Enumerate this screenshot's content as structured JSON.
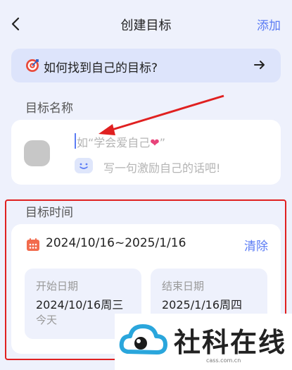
{
  "header": {
    "title": "创建目标",
    "add_label": "添加"
  },
  "tip": {
    "text": "如何找到自己的目标?"
  },
  "name_section": {
    "label": "目标名称",
    "name_placeholder_prefix": "如“学会爱自己",
    "name_placeholder_suffix": "”",
    "heart": "❤",
    "motto_placeholder": "写一句激励自己的话吧!"
  },
  "time_section": {
    "label": "目标时间",
    "range": "2024/10/16~2025/1/16",
    "clear_label": "清除",
    "start": {
      "label": "开始日期",
      "value": "2024/10/16周三",
      "note": "今天"
    },
    "end": {
      "label": "结束日期",
      "value": "2025/1/16周四",
      "note": ""
    }
  },
  "watermark": {
    "text": "社科在线",
    "url": "cass.com.cn"
  },
  "colors": {
    "accent": "#5b7cf4",
    "annotation": "#e02020",
    "background": "#eef1fc"
  }
}
